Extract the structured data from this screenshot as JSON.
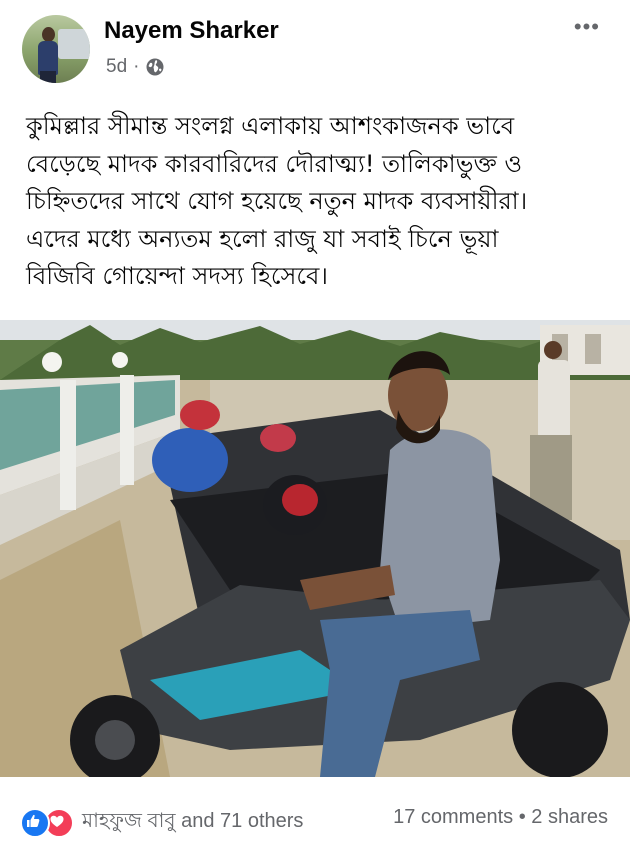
{
  "post": {
    "author": "Nayem Sharker",
    "time": "5d",
    "dot": "·",
    "privacy_icon": "globe-icon",
    "more_icon": "more-options-icon",
    "more_label": "•••",
    "text_lines": [
      "কুমিল্লার সীমান্ত সংলগ্ন এলাকায় আশংকাজনক ভাবে",
      "বেড়েছে মাদক কারবারিদের দৌরাত্ম্য! তালিকাভুক্ত ও",
      "চিহ্নিতদের সাথে যোগ হয়েছে নতুন মাদক ব্যবসায়ীরা।",
      "এদের মধ্যে অন্যতম হলো রাজু যা সবাই চিনে ভূয়া",
      "বিজিবি গোয়েন্দা সদস্য হিসেবে।"
    ]
  },
  "footer": {
    "reaction_icons": [
      "like-icon",
      "love-icon"
    ],
    "reaction_text": "মাহফুজ বাবু and 71 others",
    "comments": "17 comments",
    "separator": "•",
    "shares": "2 shares"
  },
  "colors": {
    "like": "#1877f2",
    "love": "#f33e58",
    "secondary_text": "#65676b"
  }
}
